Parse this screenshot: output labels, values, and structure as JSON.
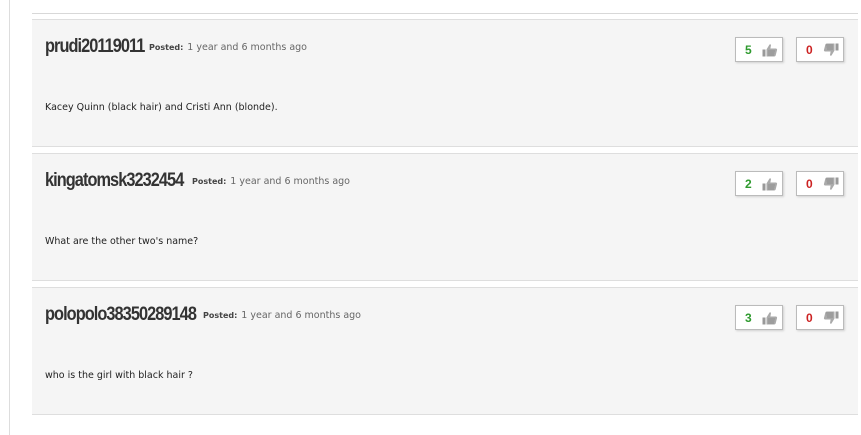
{
  "comments": [
    {
      "username": "prudi20119011",
      "posted_label": "Posted:",
      "posted_time": "1 year and 6 months ago",
      "text": "Kacey Quinn (black hair) and Cristi Ann (blonde).",
      "likes": "5",
      "dislikes": "0"
    },
    {
      "username": "kingatomsk3232454",
      "posted_label": "Posted:",
      "posted_time": "1 year and 6 months ago",
      "text": "What are the other two's name?",
      "likes": "2",
      "dislikes": "0"
    },
    {
      "username": "polopolo38350289148",
      "posted_label": "Posted:",
      "posted_time": "1 year and 6 months ago",
      "text": "who is the girl with black hair ?",
      "likes": "3",
      "dislikes": "0"
    }
  ],
  "icons": {
    "like": "thumbs-up-icon",
    "dislike": "thumbs-down-icon"
  },
  "colors": {
    "like_count": "#2e9a2e",
    "dislike_count": "#cc2222",
    "comment_background": "#f5f5f5"
  }
}
